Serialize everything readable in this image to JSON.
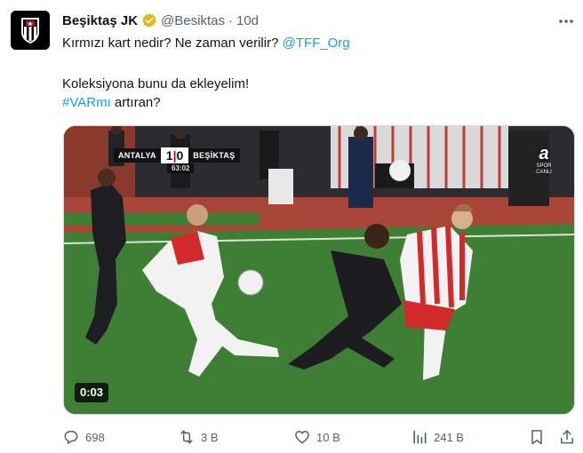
{
  "author": {
    "name": "Beşiktaş JK",
    "handle": "@Besiktas",
    "separator": "·",
    "time": "10d"
  },
  "tweet": {
    "line1_text": "Kırmızı kart nedir? Ne zaman verilir? ",
    "line1_mention": "@TFF_Org",
    "line2": "Koleksiyona bunu da ekleyelim!",
    "line3_hashtag": "#VARmı",
    "line3_text": " artıran?"
  },
  "media": {
    "scorebug_home": "ANTALYA",
    "scorebug_home_score": "1",
    "scorebug_away_score": "0",
    "scorebug_away": "BEŞİKTAŞ",
    "scorebug_clock": "63:02",
    "channel_logo": "a",
    "channel_sub1": "SPOR",
    "channel_sub2": "CANLI",
    "duration": "0:03"
  },
  "actions": {
    "replies": "698",
    "retweets": "3 B",
    "likes": "10 B",
    "views": "241 B"
  },
  "icons": {
    "verified": "verified-gold-badge-icon",
    "more": "more-horizontal-icon",
    "reply": "reply-icon",
    "retweet": "retweet-icon",
    "like": "heart-icon",
    "views": "views-chart-icon",
    "bookmark": "bookmark-icon",
    "share": "share-icon"
  },
  "colors": {
    "link": "#1d9bf0",
    "muted": "#536471",
    "verified": "#e2b719"
  }
}
